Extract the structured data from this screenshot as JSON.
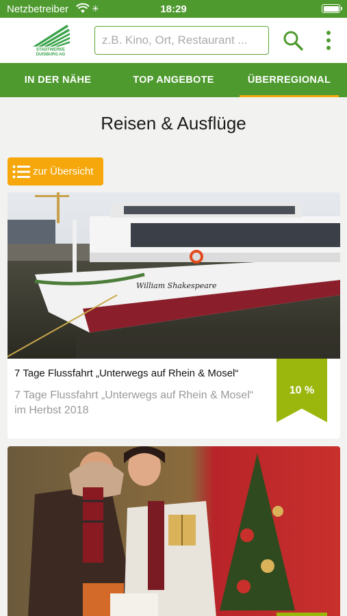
{
  "status": {
    "carrier": "Netzbetreiber",
    "time": "18:29"
  },
  "header": {
    "logo_line1": "STADTWERKE",
    "logo_line2": "DUISBURG AG",
    "search_placeholder": "z.B. Kino, Ort, Restaurant ..."
  },
  "tabs": [
    {
      "label": "IN DER NÄHE",
      "active": false
    },
    {
      "label": "TOP ANGEBOTE",
      "active": false
    },
    {
      "label": "ÜBERREGIONAL",
      "active": true
    }
  ],
  "page": {
    "title": "Reisen & Ausflüge",
    "overview_label": "zur Übersicht"
  },
  "cards": [
    {
      "title": "7 Tage Flussfahrt „Unterwegs auf Rhein & Mosel“",
      "subtitle": "7 Tage Flussfahrt „Unterwegs auf Rhein & Mosel“ im Herbst 2018",
      "discount": "10 %",
      "image_label": "William Shakespeare"
    },
    {
      "title": "",
      "subtitle": "",
      "discount": ""
    }
  ],
  "colors": {
    "brand_green": "#4e9a2e",
    "accent_orange": "#f5a70b",
    "ribbon_green": "#9bb70d"
  }
}
